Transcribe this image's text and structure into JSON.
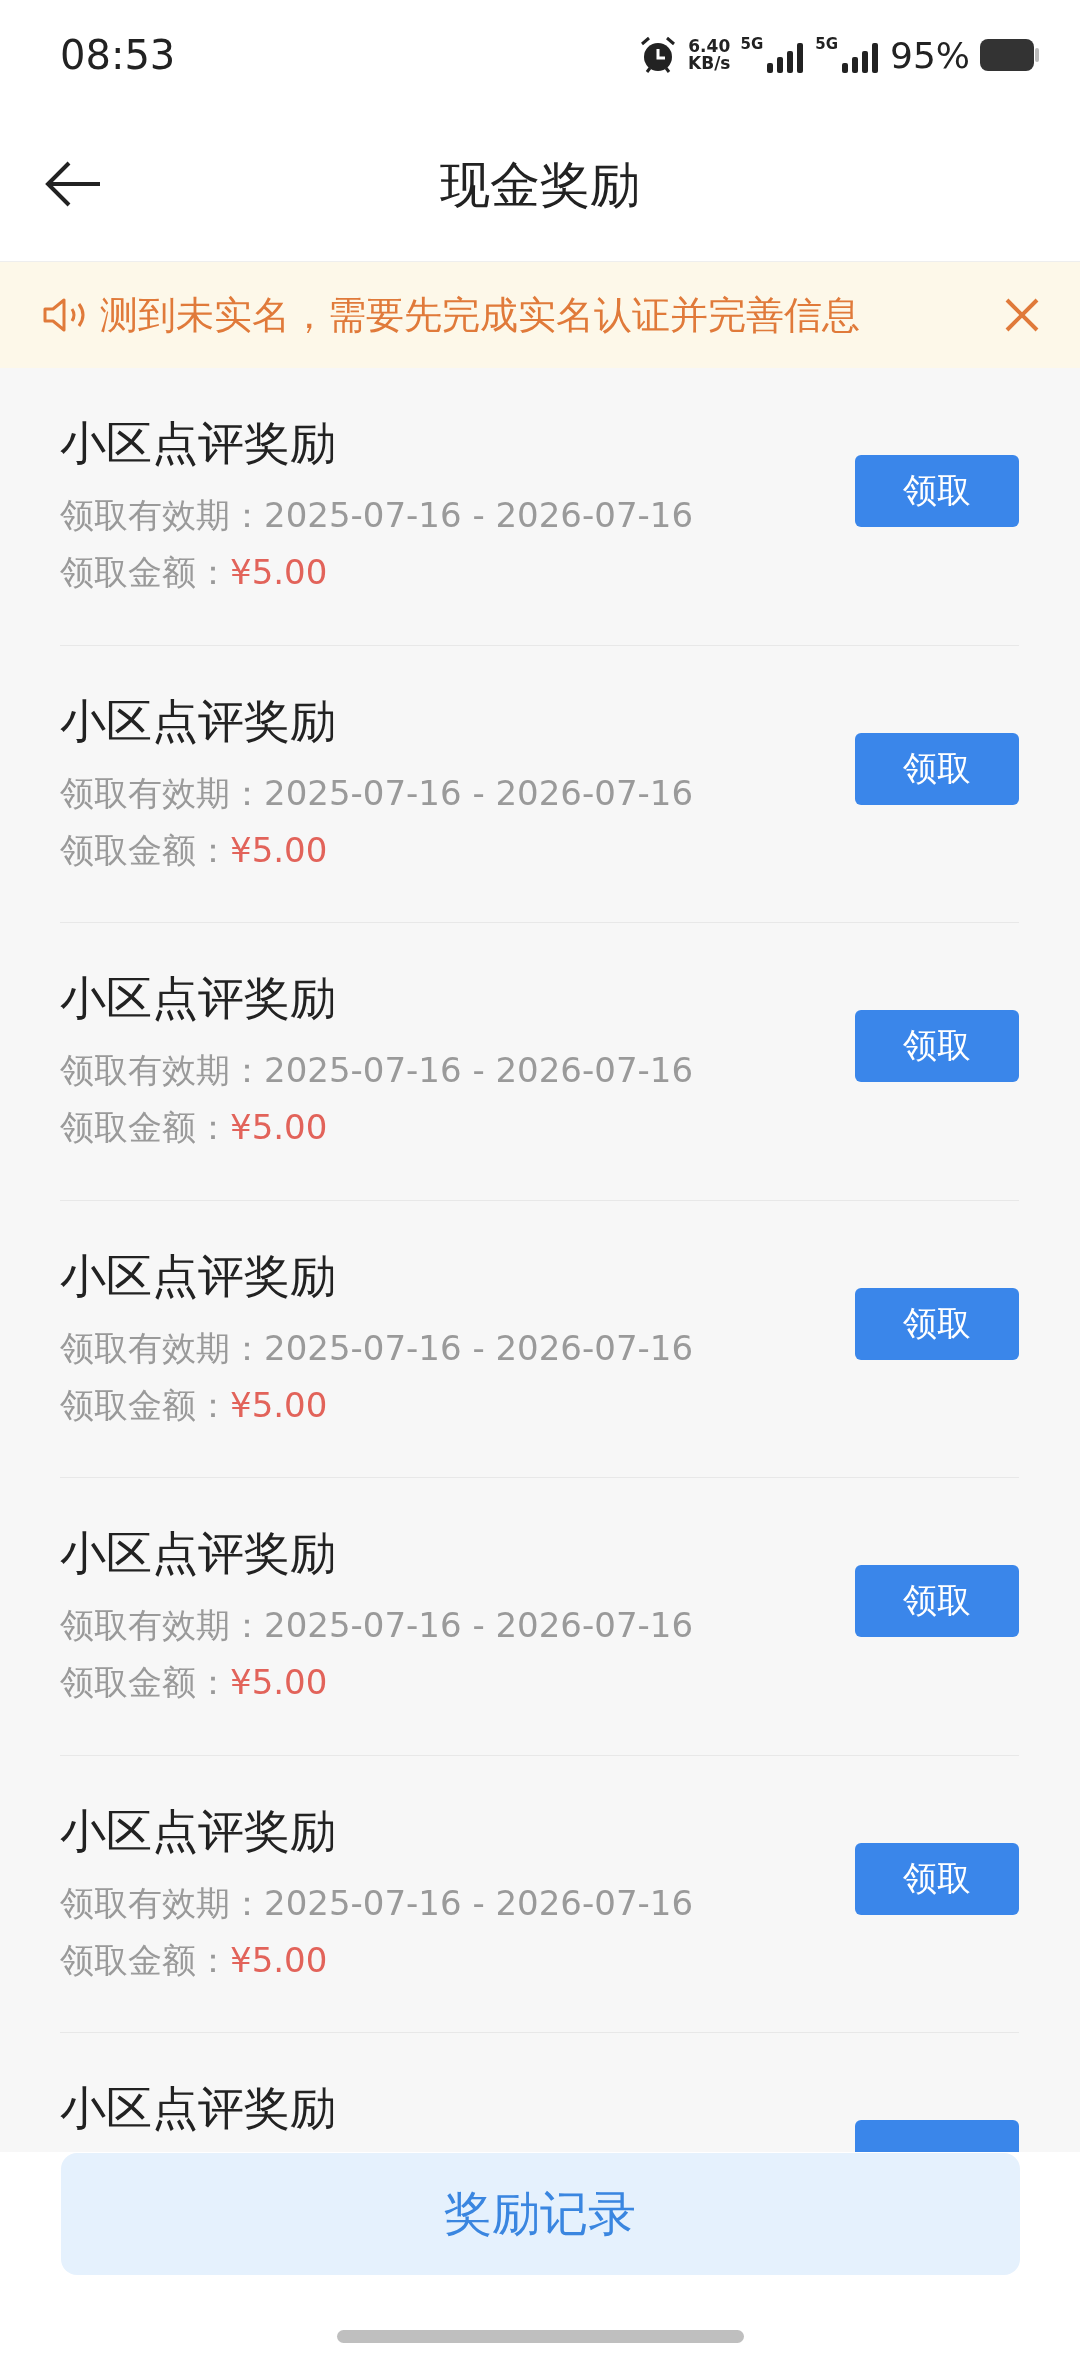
{
  "status_bar": {
    "time": "08:53",
    "net_speed": "6.40",
    "net_unit": "KB/s",
    "networks": [
      "5G",
      "5G"
    ],
    "battery": "95%"
  },
  "header": {
    "title": "现金奖励"
  },
  "notice": {
    "text": "测到未实名，需要先完成实名认证并完善信息"
  },
  "rewards": [
    {
      "title": "小区点评奖励",
      "validity": "领取有效期：2025-07-16 - 2026-07-16",
      "amount_label": "领取金额：",
      "amount": "¥5.00",
      "button": "领取"
    },
    {
      "title": "小区点评奖励",
      "validity": "领取有效期：2025-07-16 - 2026-07-16",
      "amount_label": "领取金额：",
      "amount": "¥5.00",
      "button": "领取"
    },
    {
      "title": "小区点评奖励",
      "validity": "领取有效期：2025-07-16 - 2026-07-16",
      "amount_label": "领取金额：",
      "amount": "¥5.00",
      "button": "领取"
    },
    {
      "title": "小区点评奖励",
      "validity": "领取有效期：2025-07-16 - 2026-07-16",
      "amount_label": "领取金额：",
      "amount": "¥5.00",
      "button": "领取"
    },
    {
      "title": "小区点评奖励",
      "validity": "领取有效期：2025-07-16 - 2026-07-16",
      "amount_label": "领取金额：",
      "amount": "¥5.00",
      "button": "领取"
    },
    {
      "title": "小区点评奖励",
      "validity": "领取有效期：2025-07-16 - 2026-07-16",
      "amount_label": "领取金额：",
      "amount": "¥5.00",
      "button": "领取"
    },
    {
      "title": "小区点评奖励"
    }
  ],
  "bottom": {
    "button": "奖励记录"
  }
}
